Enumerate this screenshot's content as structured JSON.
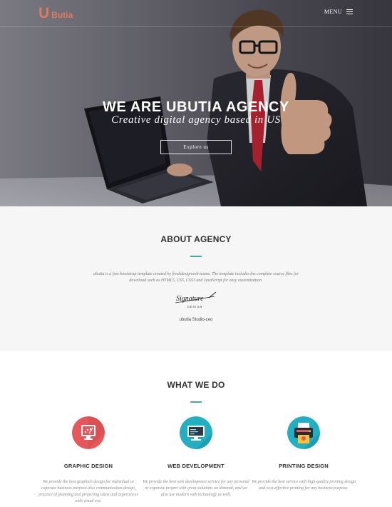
{
  "header": {
    "logo_mark": "U",
    "logo_text": "Butia",
    "menu_label": "MENU"
  },
  "hero": {
    "title": "WE ARE UBUTIA AGENCY",
    "subtitle": "Creative digital agency based in US",
    "button_label": "Explore us"
  },
  "about": {
    "title": "ABOUT AGENCY",
    "text": "ubutia is a free bootstrap template created by freshdesignweb teams. The template includes the complete source files for download such as HTML5, CSS, CSS3 and JavaScript for easy customization.",
    "signature": "Signature",
    "signature_sub": "DESIGN",
    "ceo": "ubutia Studio-ceo"
  },
  "services": {
    "title": "WHAT WE DO",
    "items": [
      {
        "name": "GRAPHIC DESIGN",
        "icon": "graphic-design-icon",
        "color": "#e5575a",
        "desc": "We provide the best graphich design for individual or coporate business purpose.also communication design, practice of planning and projecting ideas and experiences with visual eye."
      },
      {
        "name": "WEB DEVELOPMENT",
        "icon": "web-development-icon",
        "color": "#24aec2",
        "desc": "We provide the best web development service for any personal or coporate project with great solutions on demand, and we also use modern web technology as well."
      },
      {
        "name": "PRINTING DESIGN",
        "icon": "printer-icon",
        "color": "#24aec2",
        "desc": "We provide the best service with high-quality printing design and cost-effective printing for any business purpose."
      }
    ]
  },
  "colors": {
    "accent": "#e2785f",
    "divider": "#4ba89a",
    "about_bg": "#f6f6f6"
  }
}
